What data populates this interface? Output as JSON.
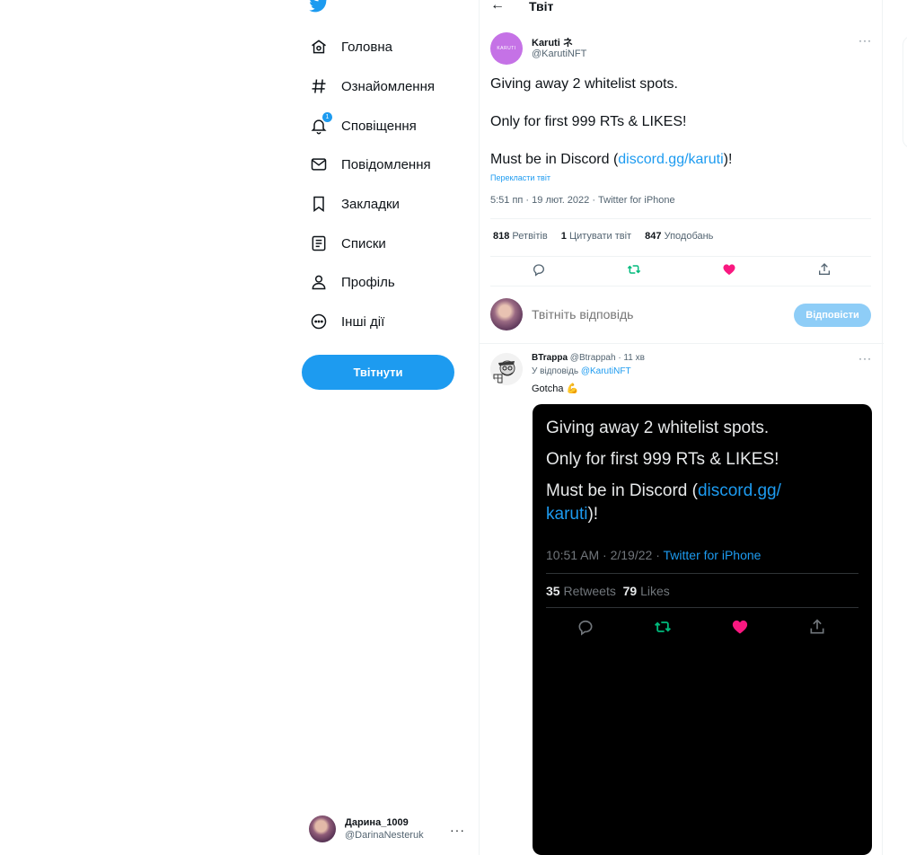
{
  "sidebar": {
    "logo": "twitter-bird-icon",
    "items": [
      {
        "label": "Головна",
        "icon": "home-icon"
      },
      {
        "label": "Ознайомлення",
        "icon": "hashtag-icon"
      },
      {
        "label": "Сповіщення",
        "icon": "bell-icon",
        "badge": "1"
      },
      {
        "label": "Повідомлення",
        "icon": "mail-icon"
      },
      {
        "label": "Закладки",
        "icon": "bookmark-icon"
      },
      {
        "label": "Списки",
        "icon": "list-icon"
      },
      {
        "label": "Профіль",
        "icon": "person-icon"
      },
      {
        "label": "Інші дії",
        "icon": "more-circle-icon"
      }
    ],
    "tweet_button": "Твітнути",
    "account": {
      "name": "Дарина_1009",
      "handle": "@DarinaNesteruk",
      "more": "···"
    }
  },
  "header": {
    "title": "Твіт",
    "back": "←"
  },
  "tweet": {
    "avatar_text": "KARUTI",
    "author_name": "Karuti ネ",
    "author_handle": "@KarutiNFT",
    "more": "···",
    "line1": "Giving away 2 whitelist spots.",
    "line2": "Only for first 999 RTs & LIKES!",
    "line3_prefix": "Must be in Discord (",
    "line3_link": "discord.gg/karuti",
    "line3_suffix": ")!",
    "translate": "Перекласти твіт",
    "meta": "5:51 пп · 19 лют. 2022 · Twitter for iPhone",
    "stats": {
      "retweets_count": "818",
      "retweets_label": "Ретвітів",
      "quotes_count": "1",
      "quotes_label": "Цитувати твіт",
      "likes_count": "847",
      "likes_label": "Уподобань"
    }
  },
  "reply_box": {
    "placeholder": "Твітніть відповідь",
    "button": "Відповісти"
  },
  "reply": {
    "name": "BTrappa",
    "handle_time": "@Btrappah · 11 хв",
    "replying_prefix": "У відповідь ",
    "replying_to": "@KarutiNFT",
    "text": "Gotcha 💪",
    "more": "···",
    "image": {
      "line1": "Giving away 2 whitelist spots.",
      "line2": "Only for first 999 RTs & LIKES!",
      "line3_prefix": "Must be in Discord (",
      "line3_link_a": "discord.gg/",
      "line4_link_b": "karuti",
      "line4_suffix": ")!",
      "meta_prefix": "10:51 AM · 2/19/22 · ",
      "meta_link": "Twitter for iPhone",
      "retweets_count": "35",
      "retweets_label": "Retweets",
      "likes_count": "79",
      "likes_label": "Likes"
    }
  },
  "colors": {
    "accent": "#1d9bf0",
    "like": "#f91880",
    "retweet": "#00ba7c",
    "text": "#0f1419",
    "muted": "#536471"
  }
}
